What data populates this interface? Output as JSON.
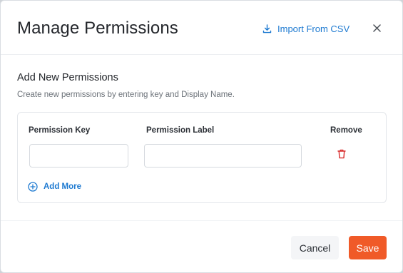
{
  "modal": {
    "title": "Manage Permissions",
    "import_label": "Import From CSV",
    "close_icon": "close-icon"
  },
  "section": {
    "title": "Add New Permissions",
    "subtitle": "Create new permissions by entering key and Display Name."
  },
  "table": {
    "columns": [
      "Permission Key",
      "Permission Label",
      "Remove"
    ],
    "rows": [
      {
        "key_value": "",
        "label_value": "",
        "remove_icon": "trash-icon"
      }
    ],
    "add_more_label": "Add More"
  },
  "footer": {
    "cancel_label": "Cancel",
    "save_label": "Save"
  },
  "colors": {
    "accent_blue": "#1e7ad1",
    "save_orange": "#f05a28",
    "delete_red": "#d92d2d"
  }
}
